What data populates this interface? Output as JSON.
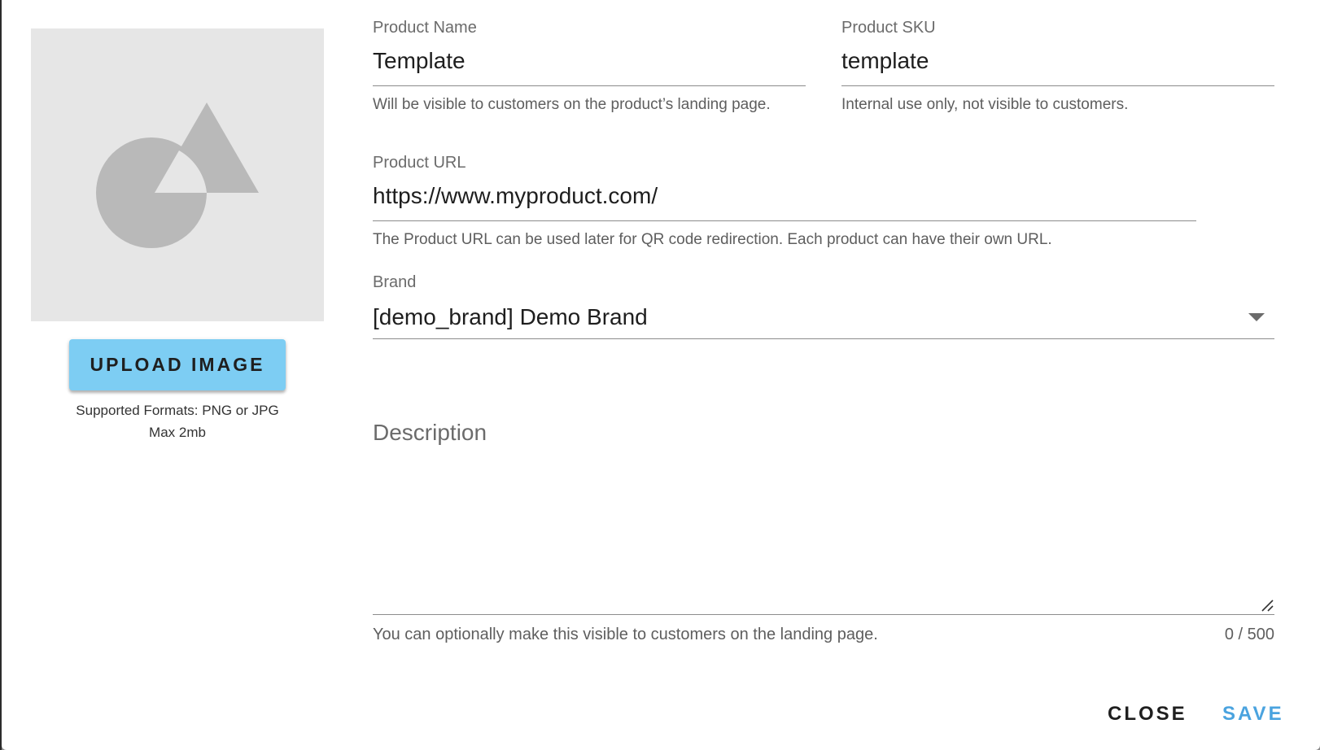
{
  "image_panel": {
    "placeholder_icon": "image-placeholder-icon",
    "upload_label": "UPLOAD IMAGE",
    "formats_text": "Supported Formats: PNG or JPG",
    "max_size_text": "Max 2mb"
  },
  "fields": {
    "product_name": {
      "label": "Product Name",
      "value": "Template",
      "hint": "Will be visible to customers on the product’s landing page."
    },
    "product_sku": {
      "label": "Product SKU",
      "value": "template",
      "hint": "Internal use only, not visible to customers."
    },
    "product_url": {
      "label": "Product URL",
      "value": "https://www.myproduct.com/",
      "hint": "The Product URL can be used later for QR code redirection. Each product can have their own URL."
    },
    "brand": {
      "label": "Brand",
      "value": "[demo_brand] Demo Brand"
    },
    "description": {
      "label": "Description",
      "value": "",
      "hint": "You can optionally make this visible to customers on the landing page.",
      "counter": "0 / 500"
    }
  },
  "actions": {
    "close_label": "CLOSE",
    "save_label": "SAVE"
  },
  "colors": {
    "upload_button": "#7dcdf3",
    "save_accent": "#4aa3df",
    "image_placeholder_bg": "#e6e6e6",
    "image_placeholder_shapes": "#b9b9b9"
  }
}
